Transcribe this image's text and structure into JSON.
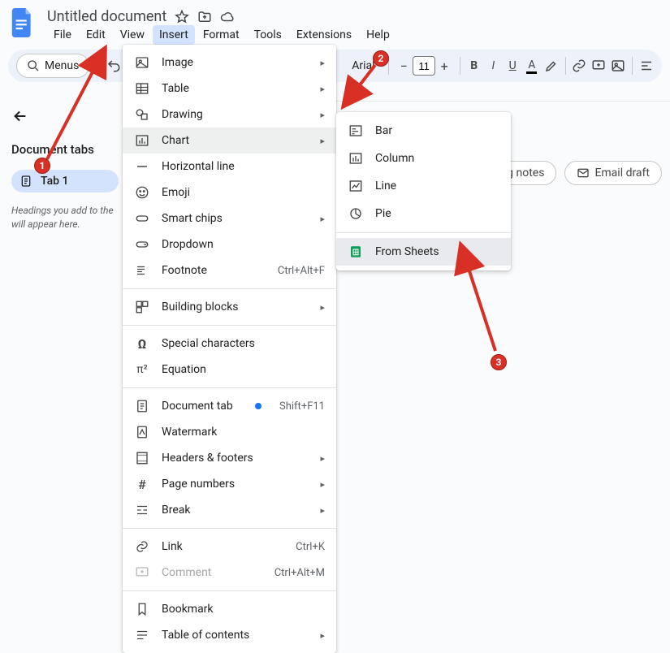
{
  "header": {
    "doc_title": "Untitled document"
  },
  "menubar": {
    "file": "File",
    "edit": "Edit",
    "view": "View",
    "insert": "Insert",
    "format": "Format",
    "tools": "Tools",
    "extensions": "Extensions",
    "help": "Help"
  },
  "toolbar": {
    "menus_chip": "Menus",
    "font_name": "Arial",
    "font_size": "11"
  },
  "left_panel": {
    "title": "Document tabs",
    "tab1_label": "Tab 1",
    "help_text": "Headings you add to the will appear here."
  },
  "insert_menu": {
    "image": "Image",
    "table": "Table",
    "drawing": "Drawing",
    "chart": "Chart",
    "hrule": "Horizontal line",
    "emoji": "Emoji",
    "smart_chips": "Smart chips",
    "dropdown": "Dropdown",
    "footnote": "Footnote",
    "footnote_shortcut": "Ctrl+Alt+F",
    "building_blocks": "Building blocks",
    "special_chars": "Special characters",
    "equation": "Equation",
    "document_tab": "Document tab",
    "document_tab_shortcut": "Shift+F11",
    "watermark": "Watermark",
    "headers_footers": "Headers & footers",
    "page_numbers": "Page numbers",
    "break": "Break",
    "link": "Link",
    "link_shortcut": "Ctrl+K",
    "comment": "Comment",
    "comment_shortcut": "Ctrl+Alt+M",
    "bookmark": "Bookmark",
    "toc": "Table of contents"
  },
  "chart_submenu": {
    "bar": "Bar",
    "column": "Column",
    "line": "Line",
    "pie": "Pie",
    "from_sheets": "From Sheets"
  },
  "chips": {
    "meeting_notes": "Meeting notes",
    "email_draft": "Email draft"
  },
  "annotations": {
    "b1": "1",
    "b2": "2",
    "b3": "3"
  }
}
